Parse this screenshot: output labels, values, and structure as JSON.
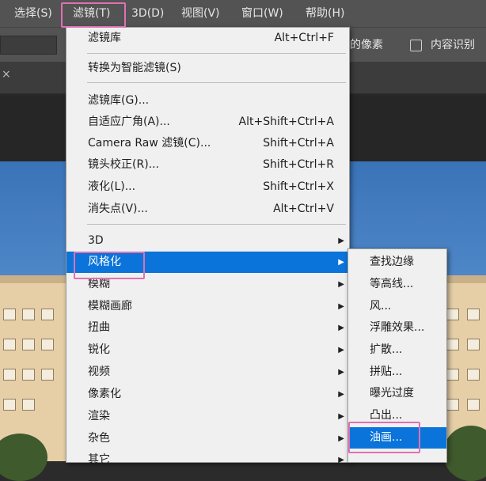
{
  "menubar": {
    "items": [
      "选择(S)",
      "滤镜(T)",
      "3D(D)",
      "视图(V)",
      "窗口(W)",
      "帮助(H)"
    ]
  },
  "options_bar": {
    "text_partial": "的像素",
    "checkbox_label": "内容识别",
    "checkbox_checked": false
  },
  "tab": {
    "close_glyph": "×"
  },
  "filter_menu": {
    "items": [
      {
        "label": "滤镜库",
        "shortcut": "Alt+Ctrl+F"
      },
      {
        "label": "转换为智能滤镜(S)",
        "shortcut": ""
      },
      {
        "label": "滤镜库(G)...",
        "shortcut": ""
      },
      {
        "label": "自适应广角(A)...",
        "shortcut": "Alt+Shift+Ctrl+A"
      },
      {
        "label": "Camera Raw 滤镜(C)...",
        "shortcut": "Shift+Ctrl+A"
      },
      {
        "label": "镜头校正(R)...",
        "shortcut": "Shift+Ctrl+R"
      },
      {
        "label": "液化(L)...",
        "shortcut": "Shift+Ctrl+X"
      },
      {
        "label": "消失点(V)...",
        "shortcut": "Alt+Ctrl+V"
      },
      {
        "label": "3D",
        "shortcut": ""
      },
      {
        "label": "风格化",
        "shortcut": ""
      },
      {
        "label": "模糊",
        "shortcut": ""
      },
      {
        "label": "模糊画廊",
        "shortcut": ""
      },
      {
        "label": "扭曲",
        "shortcut": ""
      },
      {
        "label": "锐化",
        "shortcut": ""
      },
      {
        "label": "视频",
        "shortcut": ""
      },
      {
        "label": "像素化",
        "shortcut": ""
      },
      {
        "label": "渲染",
        "shortcut": ""
      },
      {
        "label": "杂色",
        "shortcut": ""
      },
      {
        "label": "其它",
        "shortcut": ""
      }
    ],
    "highlighted": "风格化"
  },
  "stylize_submenu": {
    "items": [
      "查找边缘",
      "等高线...",
      "风...",
      "浮雕效果...",
      "扩散...",
      "拼贴...",
      "曝光过度",
      "凸出...",
      "油画..."
    ],
    "highlighted": "油画..."
  },
  "colors": {
    "menu_bg": "#f0f0f0",
    "highlight": "#0a74da",
    "annotation": "#e070b4",
    "app_chrome": "#535353"
  }
}
